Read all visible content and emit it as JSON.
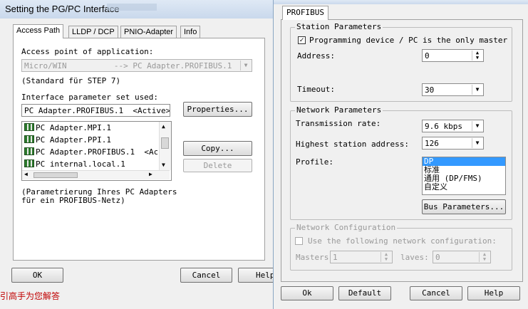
{
  "back_window": {
    "title": "Setting the PG/PC Interface",
    "tabs": [
      "Access Path",
      "LLDP / DCP",
      "PNIO-Adapter",
      "Info"
    ],
    "access_point_label": "Access point of application:",
    "access_point_value": "Micro/WIN          --> PC Adapter.PROFIBUS.1",
    "standard_note": "(Standard für STEP 7)",
    "param_set_label": "Interface parameter set used:",
    "param_set_value": "PC Adapter.PROFIBUS.1  <Active>",
    "properties_button": "Properties...",
    "list_items": [
      "PC Adapter.MPI.1",
      "PC Adapter.PPI.1",
      "PC Adapter.PROFIBUS.1  <Acti",
      "PC internal.local.1"
    ],
    "copy_button": "Copy...",
    "delete_button": "Delete",
    "note_line1": "(Parametrierung Ihres PC Adapters",
    "note_line2": "für ein PROFIBUS-Netz)",
    "ok_button": "OK",
    "cancel_button": "Cancel",
    "help_button": "Help",
    "footer_text": "引高手为您解答"
  },
  "front_window": {
    "tab": "PROFIBUS",
    "station": {
      "group_label": "Station Parameters",
      "only_master_label": "Programming device / PC is the only master on t",
      "only_master_checked": true,
      "address_label": "Address:",
      "address_value": "0",
      "timeout_label": "Timeout:",
      "timeout_value": "30"
    },
    "network": {
      "group_label": "Network Parameters",
      "transmission_label": "Transmission rate:",
      "transmission_value": "9.6 kbps",
      "highest_label": "Highest station address:",
      "highest_value": "126",
      "profile_label": "Profile:",
      "profile_options": [
        "DP",
        "标准",
        "通用 (DP/FMS)",
        "自定义"
      ],
      "profile_selected_index": 0,
      "bus_params_button": "Bus Parameters..."
    },
    "netconfig": {
      "group_label": "Network Configuration",
      "use_label": "Use the following network configuration:",
      "masters_label": "Masters",
      "masters_value": "1",
      "slaves_label": "laves:",
      "slaves_value": "0"
    },
    "ok_button": "Ok",
    "default_button": "Default",
    "cancel_button": "Cancel",
    "help_button": "Help"
  },
  "colors": {
    "selection": "#3399ff",
    "title_gradient": "#c9d8ec",
    "disabled_text": "#999999"
  }
}
